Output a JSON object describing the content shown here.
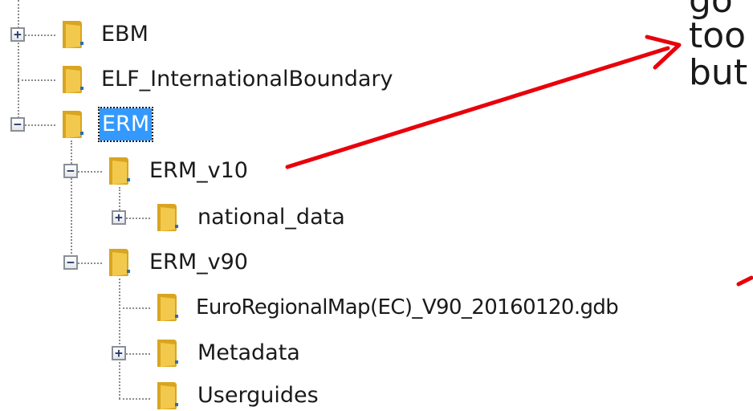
{
  "tree": {
    "nodes": [
      {
        "id": "ebm",
        "label": "EBM",
        "expander": "+",
        "selected": false
      },
      {
        "id": "elf",
        "label": "ELF_InternationalBoundary",
        "expander": "",
        "selected": false
      },
      {
        "id": "erm",
        "label": "ERM",
        "expander": "−",
        "selected": true
      },
      {
        "id": "erm_v10",
        "label": "ERM_v10",
        "expander": "−",
        "selected": false
      },
      {
        "id": "national_data",
        "label": "national_data",
        "expander": "+",
        "selected": false
      },
      {
        "id": "erm_v90",
        "label": "ERM_v90",
        "expander": "−",
        "selected": false
      },
      {
        "id": "gdb",
        "label": "EuroRegionalMap(EC)_V90_20160120.gdb",
        "expander": "",
        "selected": false
      },
      {
        "id": "metadata",
        "label": "Metadata",
        "expander": "+",
        "selected": false
      },
      {
        "id": "userguides",
        "label": "Userguides",
        "expander": "",
        "selected": false
      }
    ]
  },
  "annotation": {
    "text_lines": [
      "go",
      "too",
      "but"
    ],
    "arrow_color": "#e8000b"
  },
  "colors": {
    "selection_bg": "#3399ff",
    "folder_body": "#f2c94c",
    "folder_dark": "#d9a520"
  },
  "icons": {
    "folder": "folder-icon",
    "expand": "expand-icon",
    "collapse": "collapse-icon"
  }
}
